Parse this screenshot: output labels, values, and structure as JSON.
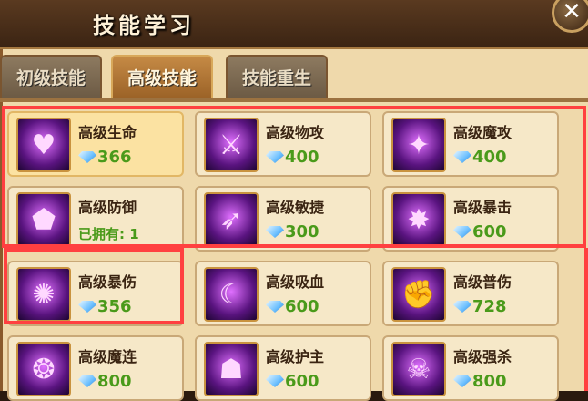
{
  "window": {
    "title": "技能学习",
    "close_glyph": "✕"
  },
  "tabs": [
    {
      "label": "初级技能",
      "active": false
    },
    {
      "label": "高级技能",
      "active": true
    },
    {
      "label": "技能重生",
      "active": false
    }
  ],
  "skills": [
    {
      "name": "高级生命",
      "cost": "366",
      "icon": "heart-icon",
      "glyph": "♥"
    },
    {
      "name": "高级物攻",
      "cost": "400",
      "icon": "axe-icon",
      "glyph": "⚔"
    },
    {
      "name": "高级魔攻",
      "cost": "400",
      "icon": "magic-figure-icon",
      "glyph": "✦"
    },
    {
      "name": "高级防御",
      "owned": "已拥有:  1",
      "icon": "shield-icon",
      "glyph": "⬟"
    },
    {
      "name": "高级敏捷",
      "cost": "300",
      "icon": "dash-icon",
      "glyph": "➶"
    },
    {
      "name": "高级暴击",
      "cost": "600",
      "icon": "critical-hit-icon",
      "glyph": "✸"
    },
    {
      "name": "高级暴伤",
      "cost": "356",
      "icon": "burst-icon",
      "glyph": "✺"
    },
    {
      "name": "高级吸血",
      "cost": "600",
      "icon": "lifesteal-icon",
      "glyph": "☾"
    },
    {
      "name": "高级普伤",
      "cost": "728",
      "icon": "fist-icon",
      "glyph": "✊"
    },
    {
      "name": "高级魔连",
      "cost": "800",
      "icon": "magic-chain-icon",
      "glyph": "❂"
    },
    {
      "name": "高级护主",
      "cost": "600",
      "icon": "guardian-icon",
      "glyph": "☗"
    },
    {
      "name": "高级强杀",
      "cost": "800",
      "icon": "strong-kill-icon",
      "glyph": "☠"
    }
  ],
  "colors": {
    "highlight": "#ff4040",
    "cost": "#4a9a1a"
  }
}
